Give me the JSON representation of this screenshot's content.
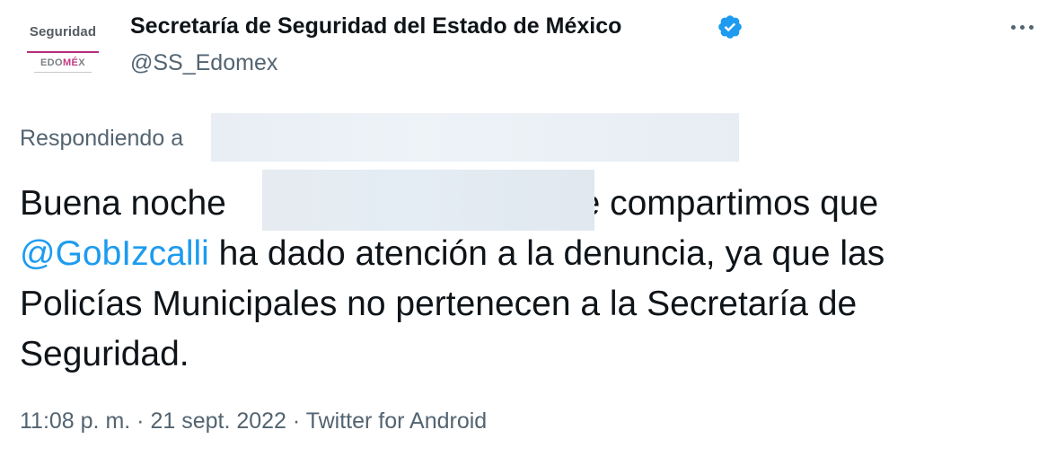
{
  "account": {
    "avatar_top_text": "Seguridad",
    "avatar_edomex_prefix": "EDO",
    "avatar_edomex_mid": "MÉ",
    "avatar_edomex_suffix": "X",
    "display_name": "Secretaría de Seguridad del Estado de México",
    "handle": "@SS_Edomex",
    "verified": true,
    "verified_icon": "verified-badge-icon",
    "verified_color": "#1d9bf0"
  },
  "actions": {
    "more_icon": "more-dots-icon"
  },
  "reply": {
    "prefix": "Respondiendo a"
  },
  "tweet": {
    "line1_start": "Buena noche",
    "line1_end": "Le compartimos que",
    "mention": "@GobIzcalli",
    "line2_rest": " ha dado atención a la denuncia, ya que las",
    "line3": "Policías Municipales no pertenecen a la Secretaría de",
    "line4": "Seguridad."
  },
  "meta": {
    "time": "11:08 p. m.",
    "separator1": " · ",
    "date": "21 sept. 2022",
    "separator2": " · ",
    "source": "Twitter for Android"
  },
  "colors": {
    "text_primary": "#0f1419",
    "text_secondary": "#536471",
    "link": "#1d9bf0",
    "brand_magenta": "#c43a86"
  }
}
